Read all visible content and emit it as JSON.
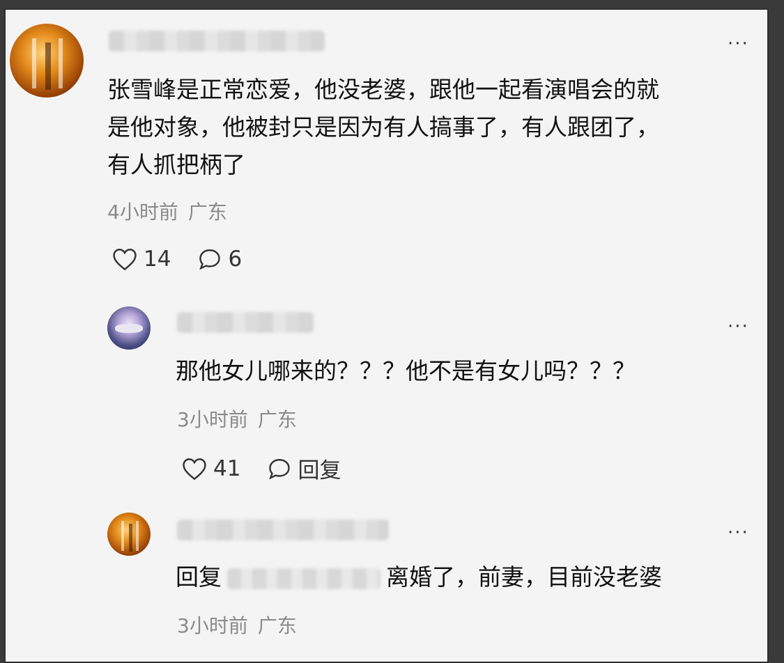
{
  "comments": [
    {
      "text_lines": [
        "张雪峰是正常恋爱，他没老婆，跟他一起看演唱会的就",
        "是他对象，他被封只是因为有人搞事了，有人跟团了，",
        "有人抓把柄了"
      ],
      "time": "4小时前",
      "location": "广东",
      "likes": "14",
      "replies": "6",
      "more": "···"
    },
    {
      "text": "那他女儿哪来的？？？他不是有女儿吗？？？",
      "time": "3小时前",
      "location": "广东",
      "likes": "41",
      "reply_label": "回复",
      "more": "···"
    },
    {
      "reply_prefix": "回复",
      "text": "离婚了，前妻，目前没老婆",
      "time": "3小时前",
      "location": "广东",
      "more": "···"
    }
  ],
  "icons": {
    "like": "heart-icon",
    "comment": "comment-bubble-icon",
    "more": "more-icon"
  },
  "colors": {
    "text": "#111111",
    "meta": "#8a8a8a",
    "background": "#f4f4f4"
  }
}
